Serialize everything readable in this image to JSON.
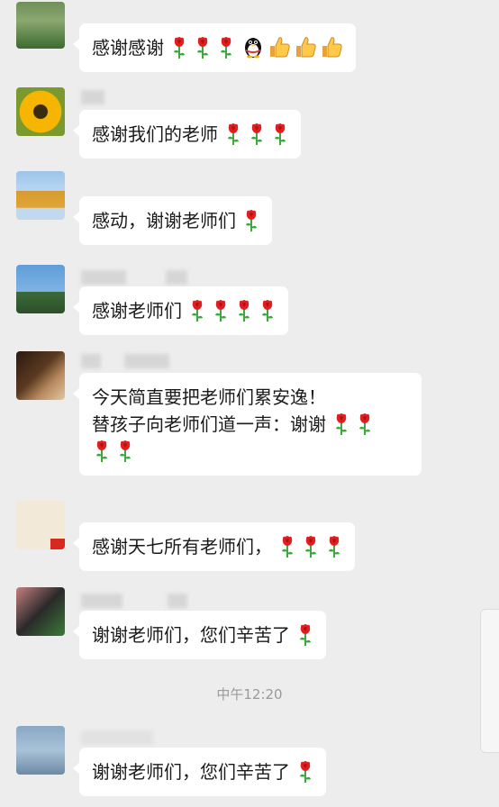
{
  "messages": [
    {
      "text": "感谢感谢",
      "roses": 3,
      "extras": [
        "qq-penguin",
        "thumbs-up",
        "thumbs-up",
        "thumbs-up"
      ]
    },
    {
      "text": "感谢我们的老师",
      "roses": 3
    },
    {
      "text": "感动，谢谢老师们",
      "roses": 1
    },
    {
      "text": "感谢老师们",
      "roses": 4
    },
    {
      "line1": "今天简直要把老师们累安逸！",
      "line2": "替孩子向老师们道一声：谢谢",
      "line2_roses": 2,
      "line3_roses": 2
    },
    {
      "text": "感谢天七所有老师们，",
      "roses": 3
    },
    {
      "text": "谢谢老师们，您们辛苦了",
      "roses": 1
    },
    {
      "text": "谢谢老师们，您们辛苦了",
      "roses": 1
    }
  ],
  "timestamp": "中午12:20",
  "colors": {
    "background": "#ededed",
    "bubble": "#ffffff",
    "rose_red": "#e02020",
    "stem_green": "#2e9a2e"
  }
}
